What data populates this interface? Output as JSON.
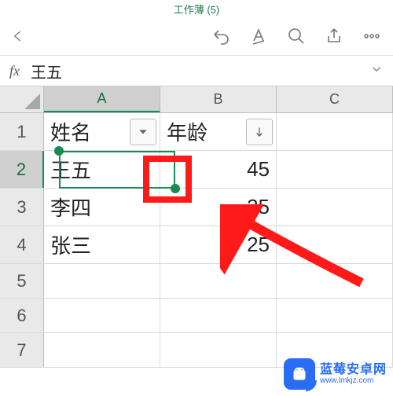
{
  "title": "工作薄 (5)",
  "fx": {
    "label": "fx",
    "value": "王五"
  },
  "columns": [
    "A",
    "B",
    "C"
  ],
  "rows": [
    "1",
    "2",
    "3",
    "4",
    "5",
    "6",
    "7"
  ],
  "headers": {
    "A": "姓名",
    "B": "年龄"
  },
  "data": [
    {
      "A": "王五",
      "B": "45"
    },
    {
      "A": "李四",
      "B": "35"
    },
    {
      "A": "张三",
      "B": "25"
    }
  ],
  "selected": {
    "row": 2,
    "col": "A"
  },
  "watermark": {
    "title": "蓝莓安卓网",
    "url": "www.lmkjz.com"
  }
}
